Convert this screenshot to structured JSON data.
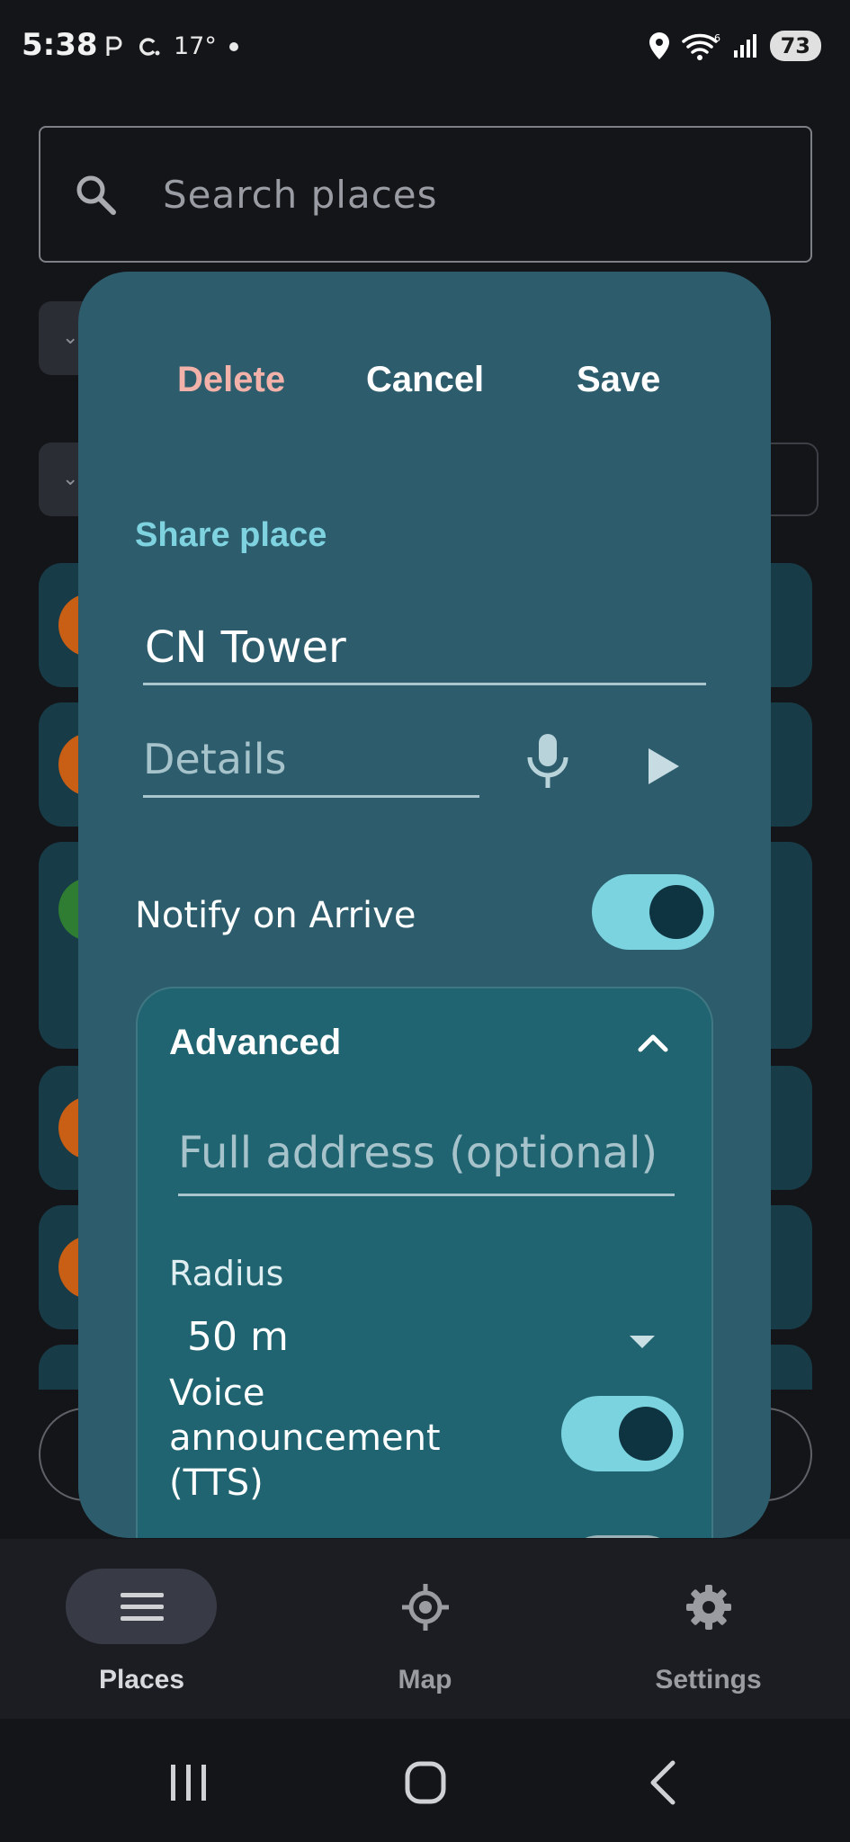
{
  "status_bar": {
    "time": "5:38",
    "temperature": "17°",
    "battery": "73"
  },
  "background": {
    "search_placeholder": "Search places"
  },
  "dialog": {
    "delete_label": "Delete",
    "cancel_label": "Cancel",
    "save_label": "Save",
    "share_label": "Share place",
    "name_value": "CN Tower",
    "details_placeholder": "Details",
    "notify_label": "Notify on Arrive",
    "notify_enabled": true,
    "advanced": {
      "title": "Advanced",
      "address_placeholder": "Full address (optional)",
      "radius_label": "Radius",
      "radius_value": "50 m",
      "voice_label": "Voice announcement (TTS)",
      "voice_enabled": true
    }
  },
  "bottom_nav": {
    "items": [
      {
        "label": "Places",
        "icon": "menu-icon",
        "active": true
      },
      {
        "label": "Map",
        "icon": "crosshair-icon",
        "active": false
      },
      {
        "label": "Settings",
        "icon": "gear-icon",
        "active": false
      }
    ]
  },
  "colors": {
    "dialog_bg": "#2d5d6c",
    "advanced_bg": "#1f6470",
    "accent": "#7bd3e0",
    "delete": "#f2b2aa"
  }
}
